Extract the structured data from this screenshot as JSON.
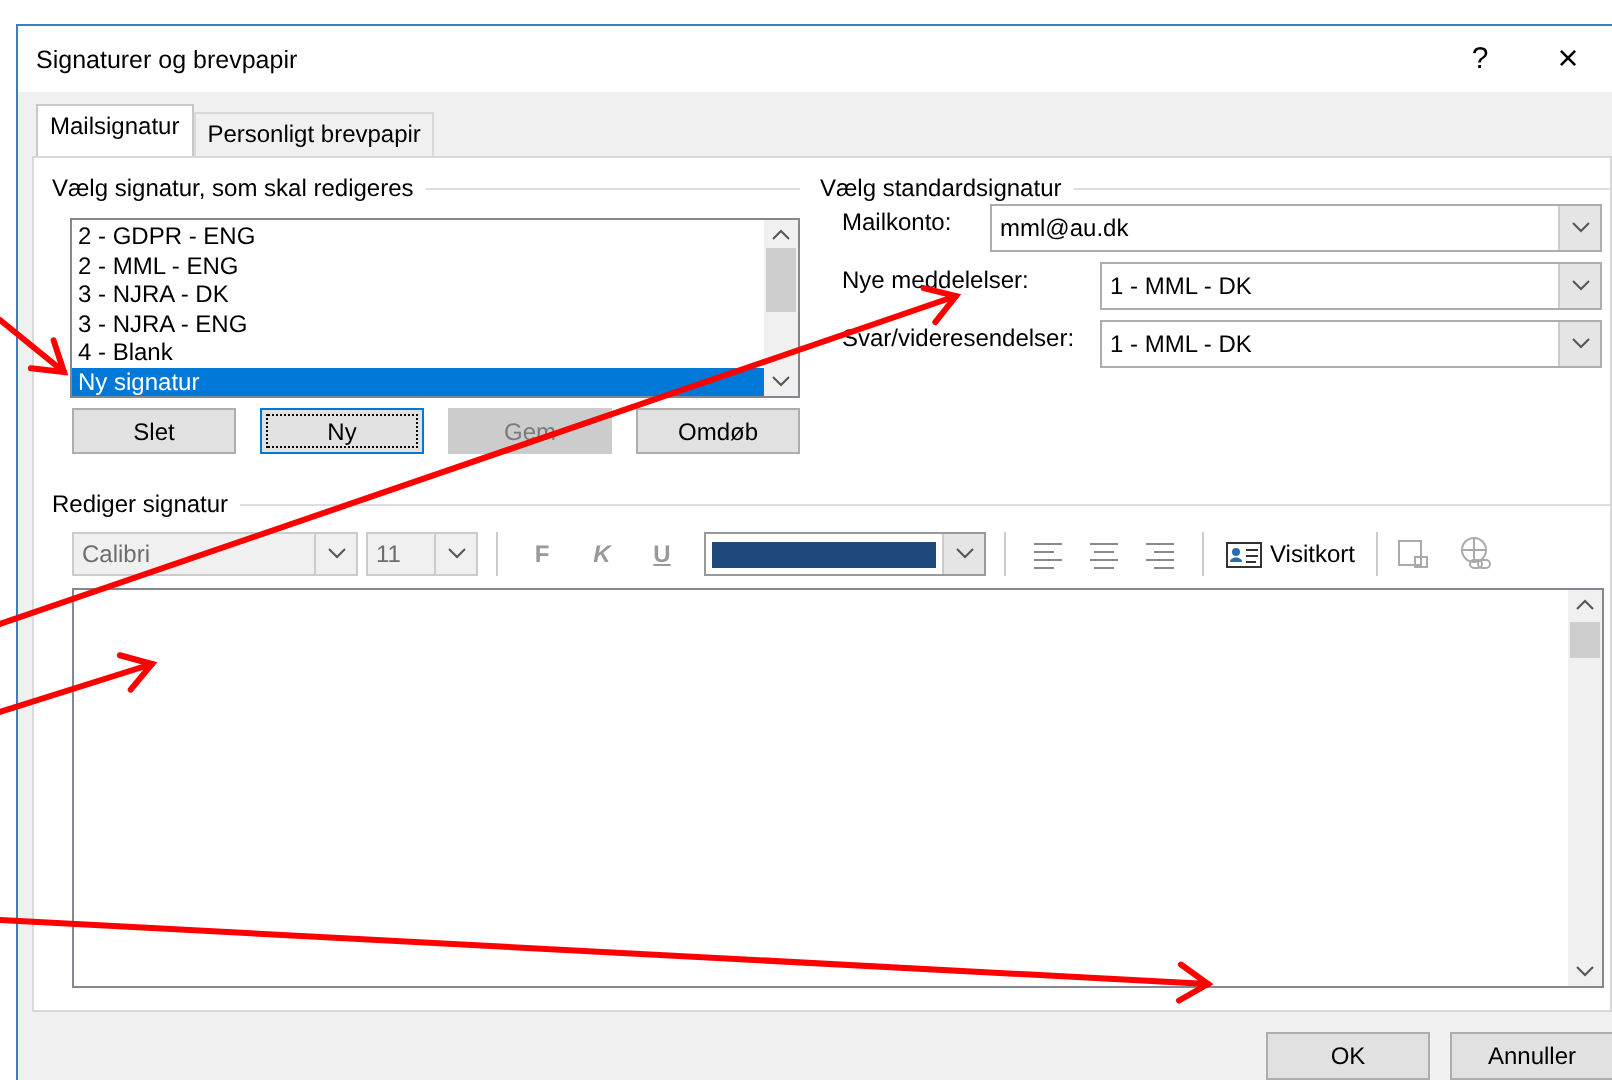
{
  "window": {
    "title": "Signaturer og brevpapir",
    "help": "?",
    "close": "×"
  },
  "tabs": [
    {
      "label": "Mailsignatur",
      "selected": true
    },
    {
      "label": "Personligt brevpapir",
      "selected": false
    }
  ],
  "signature_group": {
    "label": "Vælg signatur, som skal redigeres",
    "signatures": [
      {
        "name": "2 - GDPR - ENG",
        "selected": false
      },
      {
        "name": "2 - MML - ENG",
        "selected": false
      },
      {
        "name": "3 - NJRA - DK",
        "selected": false
      },
      {
        "name": "3 - NJRA - ENG",
        "selected": false
      },
      {
        "name": "4 - Blank",
        "selected": false
      },
      {
        "name": "Ny signatur",
        "selected": true
      }
    ],
    "buttons": [
      {
        "label": "Slet",
        "disabled": false,
        "focused": false
      },
      {
        "label": "Ny",
        "disabled": false,
        "focused": true
      },
      {
        "label": "Gem",
        "disabled": true,
        "focused": false
      },
      {
        "label": "Omdøb",
        "disabled": false,
        "focused": false
      }
    ]
  },
  "default_group": {
    "label": "Vælg standardsignatur",
    "fields": [
      {
        "label": "Mailkonto:",
        "value": "mml@au.dk"
      },
      {
        "label": "Nye meddelelser:",
        "value": "1 - MML - DK"
      },
      {
        "label": "Svar/videresendelser:",
        "value": "1 - MML - DK"
      }
    ]
  },
  "editor": {
    "label": "Rediger signatur",
    "font": {
      "value": "Calibri",
      "disabled": true
    },
    "size": {
      "value": "11",
      "disabled": true
    },
    "styles": [
      "F",
      "K",
      "U"
    ],
    "card_button": "Visitkort"
  },
  "footer_buttons": [
    "OK",
    "Annuller"
  ]
}
